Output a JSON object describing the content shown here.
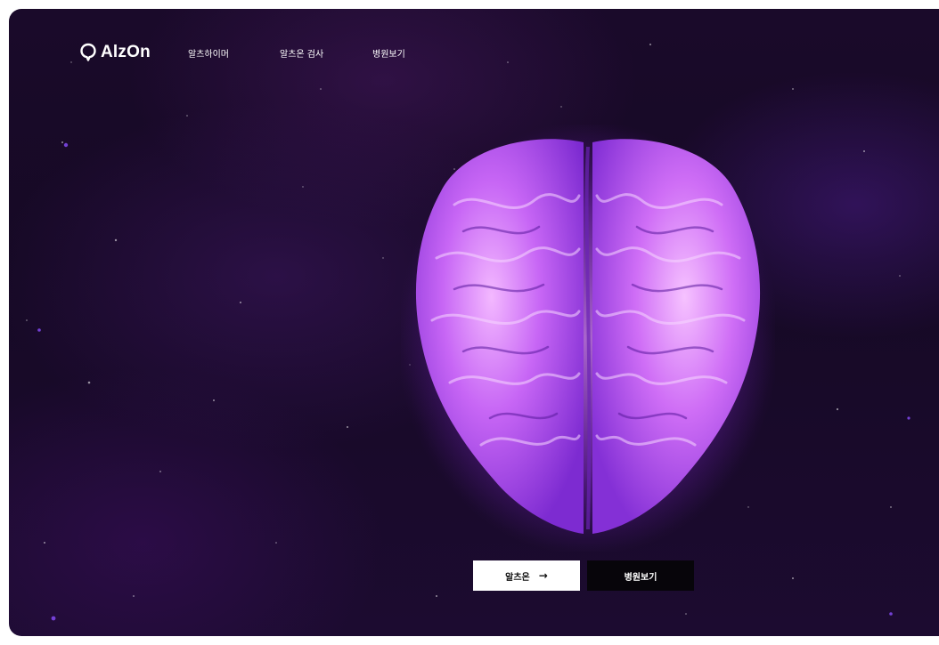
{
  "brand": {
    "name": "AlzOn"
  },
  "nav": {
    "items": [
      {
        "label": "알츠하이머"
      },
      {
        "label": "알츠온 검사"
      },
      {
        "label": "병원보기"
      }
    ]
  },
  "hero": {
    "image": "glowing-brain-icon",
    "primary_button": {
      "label": "알츠온",
      "icon": "arrow-right-icon"
    },
    "secondary_button": {
      "label": "병원보기"
    }
  },
  "colors": {
    "background": "#1a0a2a",
    "brain_glow": "#b24bff",
    "primary_button_bg": "#ffffff",
    "secondary_button_bg": "#07050a"
  }
}
